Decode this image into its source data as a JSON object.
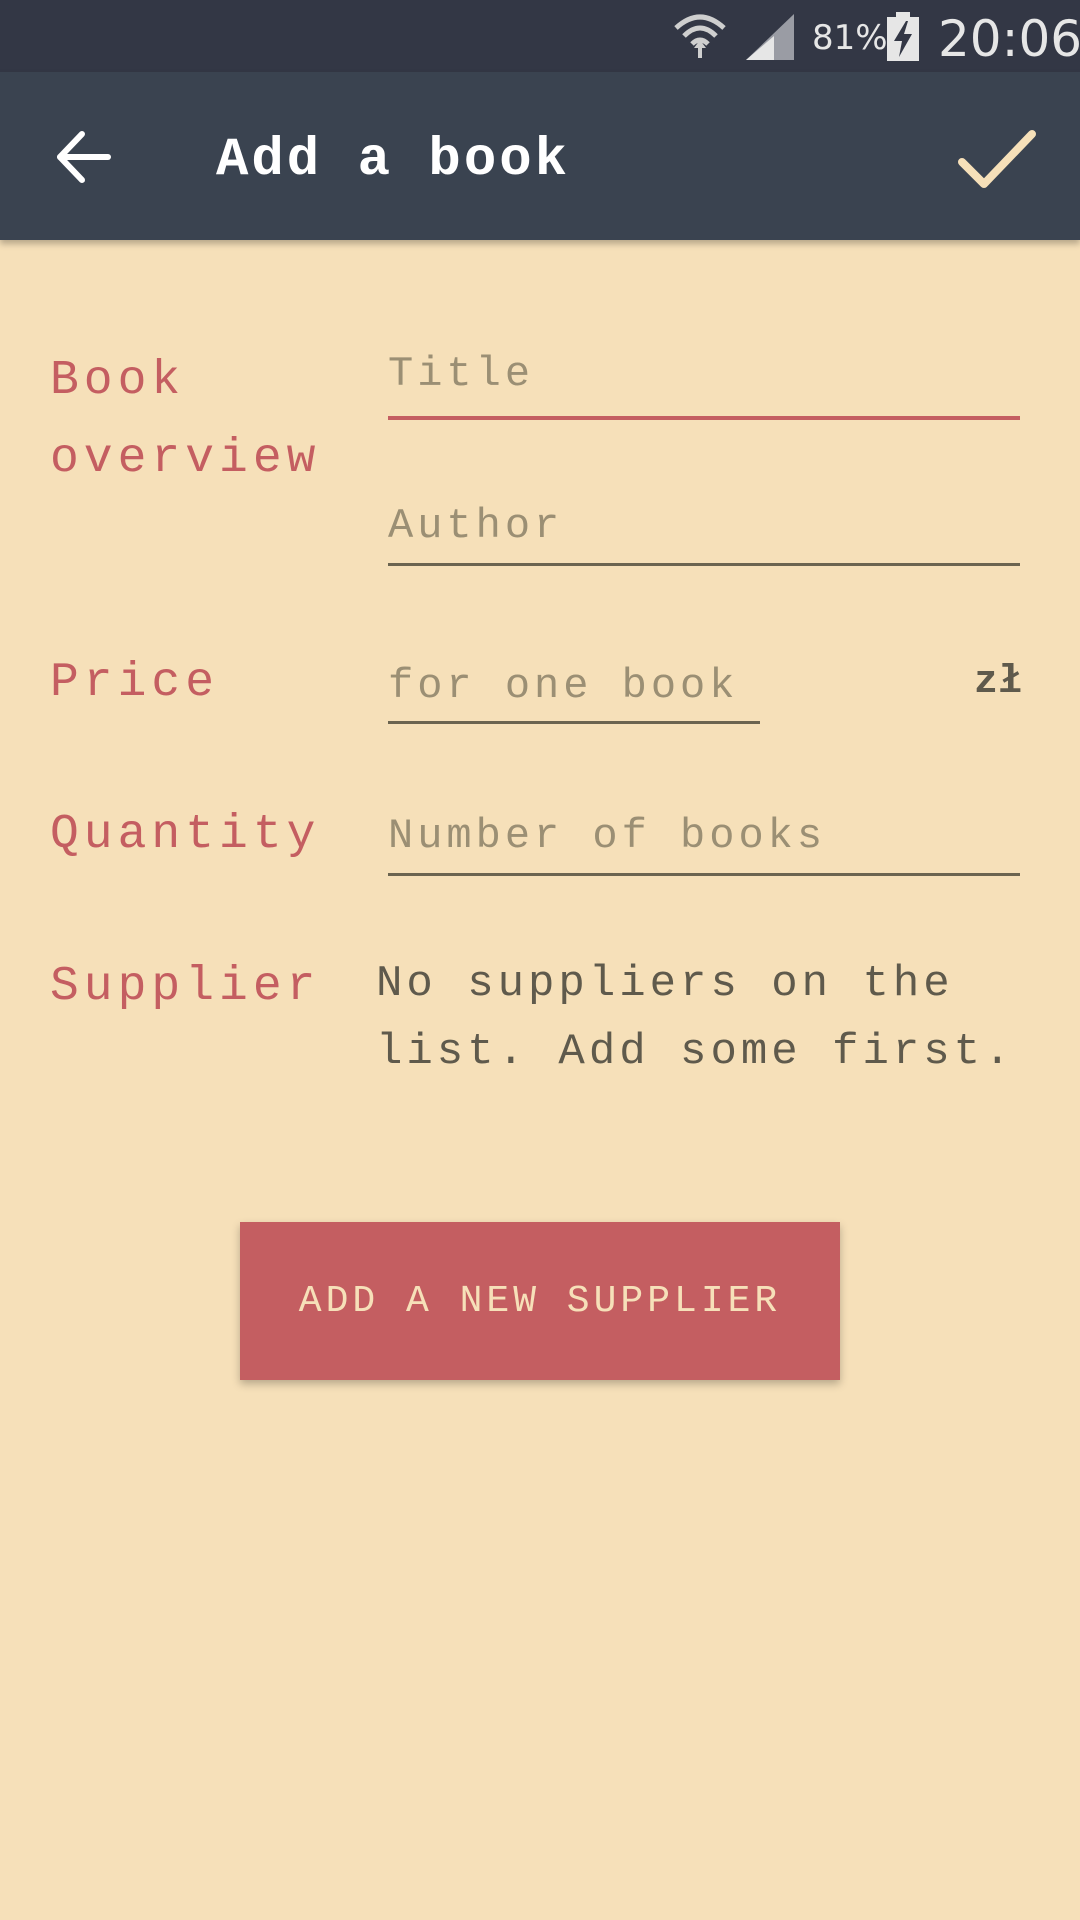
{
  "status_bar": {
    "battery_percent": "81%",
    "time": "20:06",
    "icons": [
      "wifi-icon",
      "signal-icon",
      "battery-charging-icon"
    ]
  },
  "app_bar": {
    "title": "Add a book",
    "back_icon": "arrow-left-icon",
    "confirm_icon": "check-icon"
  },
  "form": {
    "book_overview": {
      "label": "Book overview",
      "title_placeholder": "Title",
      "author_placeholder": "Author"
    },
    "price": {
      "label": "Price",
      "placeholder": "for one book",
      "currency": "zł"
    },
    "quantity": {
      "label": "Quantity",
      "placeholder": "Number of books"
    },
    "supplier": {
      "label": "Supplier",
      "message": "No suppliers on the list. Add some first."
    }
  },
  "actions": {
    "add_supplier_label": "ADD A NEW SUPPLIER"
  },
  "colors": {
    "background": "#f6e0b9",
    "app_bar": "#3a4350",
    "status_bar": "#333745",
    "accent": "#c45e61",
    "check": "#f6e0b9"
  }
}
